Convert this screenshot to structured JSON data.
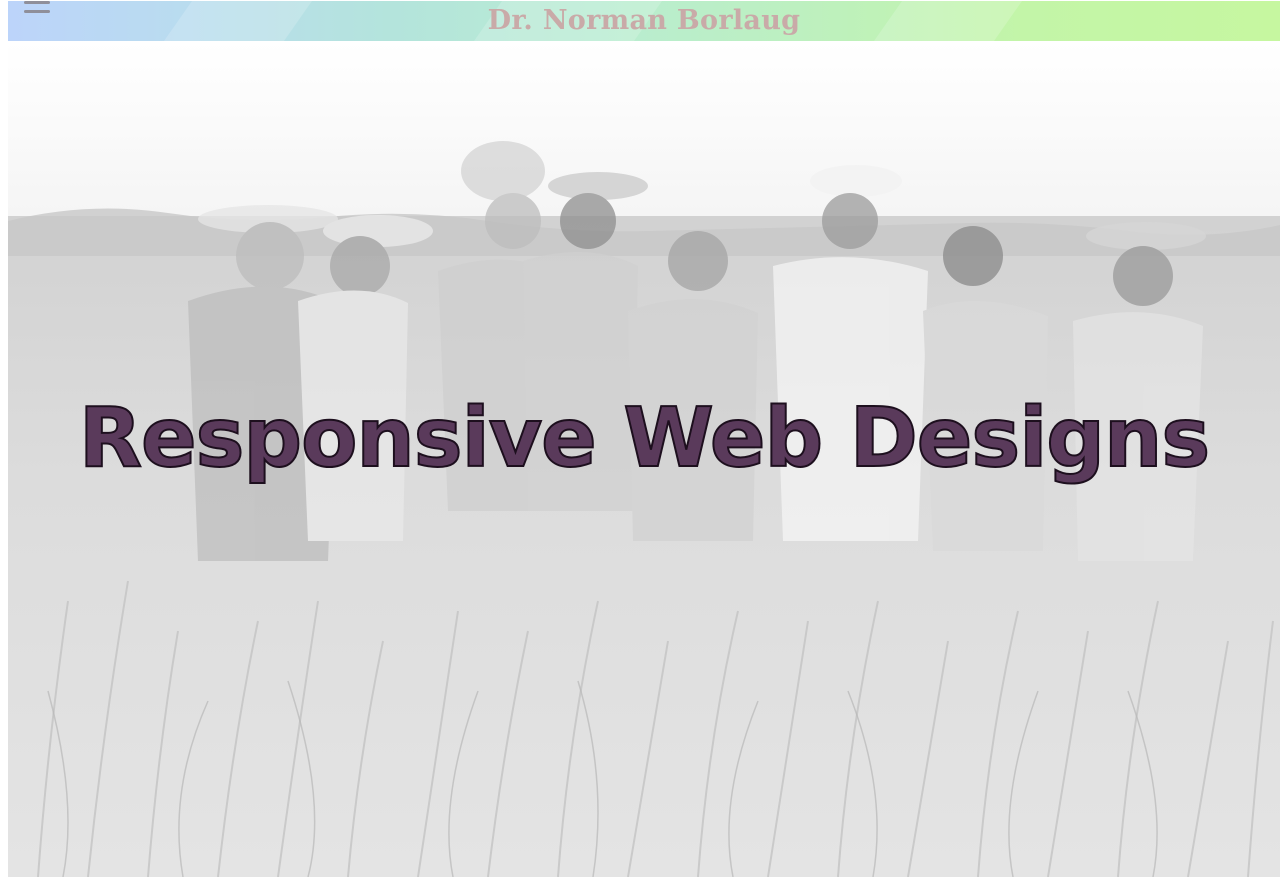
{
  "header": {
    "menu_icon": "hamburger-menu-icon",
    "title": "Dr. Norman Borlaug"
  },
  "hero": {
    "heading": "Responsive Web Designs",
    "background_image": "black-and-white photo of eight men in hats standing in a wheat field",
    "heading_color": "#5a3a5b"
  },
  "colors": {
    "header_gradient_start": "#bcd4fa",
    "header_gradient_end": "#c6f7a0",
    "title_color": "#c9aaa8"
  }
}
